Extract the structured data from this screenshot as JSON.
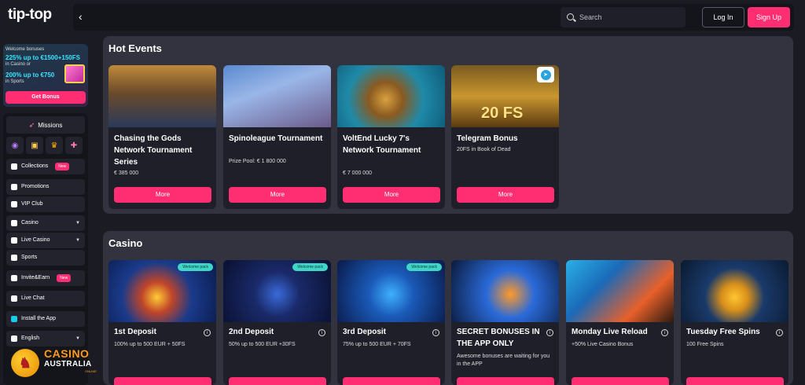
{
  "app": {
    "logo_text": "tip-top"
  },
  "promo": {
    "line1": "Welcome bonuses",
    "line2": "225% up to €1500+150FS",
    "line3": "in Casino or",
    "line4": "200% up to €750",
    "line5": "in Sports",
    "button": "Get Bonus"
  },
  "sidebar": {
    "missions": "Missions",
    "items": [
      {
        "label": "Collections",
        "badge": "New"
      },
      {
        "label": "Promotions"
      },
      {
        "label": "VIP Club"
      },
      {
        "label": "Casino"
      },
      {
        "label": "Live Casino"
      },
      {
        "label": "Sports"
      },
      {
        "label": "Invite&Earn",
        "badge": "New"
      },
      {
        "label": "Live Chat"
      },
      {
        "label": "Install the App"
      },
      {
        "label": "English"
      }
    ]
  },
  "header": {
    "search_placeholder": "Search",
    "login": "Log In",
    "signup": "Sign Up"
  },
  "hot_events": {
    "title": "Hot Events",
    "cards": [
      {
        "title": "Chasing the Gods Network Tournament Series",
        "sub": "€ 385 000",
        "button": "More"
      },
      {
        "title": "Spinoleague Tournament",
        "sub": "Prize Pool: € 1 800 000",
        "button": "More"
      },
      {
        "title": "VoltEnd Lucky 7's Network Tournament",
        "sub": "€ 7 000 000",
        "button": "More"
      },
      {
        "title": "Telegram Bonus",
        "sub": "20FS in Book of Dead",
        "button": "More",
        "image_text": "20 FS"
      }
    ]
  },
  "casino": {
    "title": "Casino",
    "cards": [
      {
        "title": "1st Deposit",
        "sub": "100% up to 500 EUR + 50FS",
        "badge": "Welcome pack"
      },
      {
        "title": "2nd Deposit",
        "sub": "50% up to 500 EUR +30FS",
        "badge": "Welcome pack"
      },
      {
        "title": "3rd Deposit",
        "sub": "75% up to 500 EUR + 70FS",
        "badge": "Welcome pack"
      },
      {
        "title": "SECRET BONUSES IN THE APP ONLY",
        "sub": "Awesome bonuses are waiting for you in the APP"
      },
      {
        "title": "Monday Live Reload",
        "sub": "+50% Live Casino Bonus"
      },
      {
        "title": "Tuesday Free Spins",
        "sub": "100 Free Spins"
      }
    ]
  },
  "watermark": {
    "line1": "CASINO",
    "line2": "AUSTRALIA",
    "line3": "ONLINE"
  },
  "colors": {
    "accent": "#ff2d72",
    "panel": "#33333f",
    "card": "#1f1f29"
  }
}
